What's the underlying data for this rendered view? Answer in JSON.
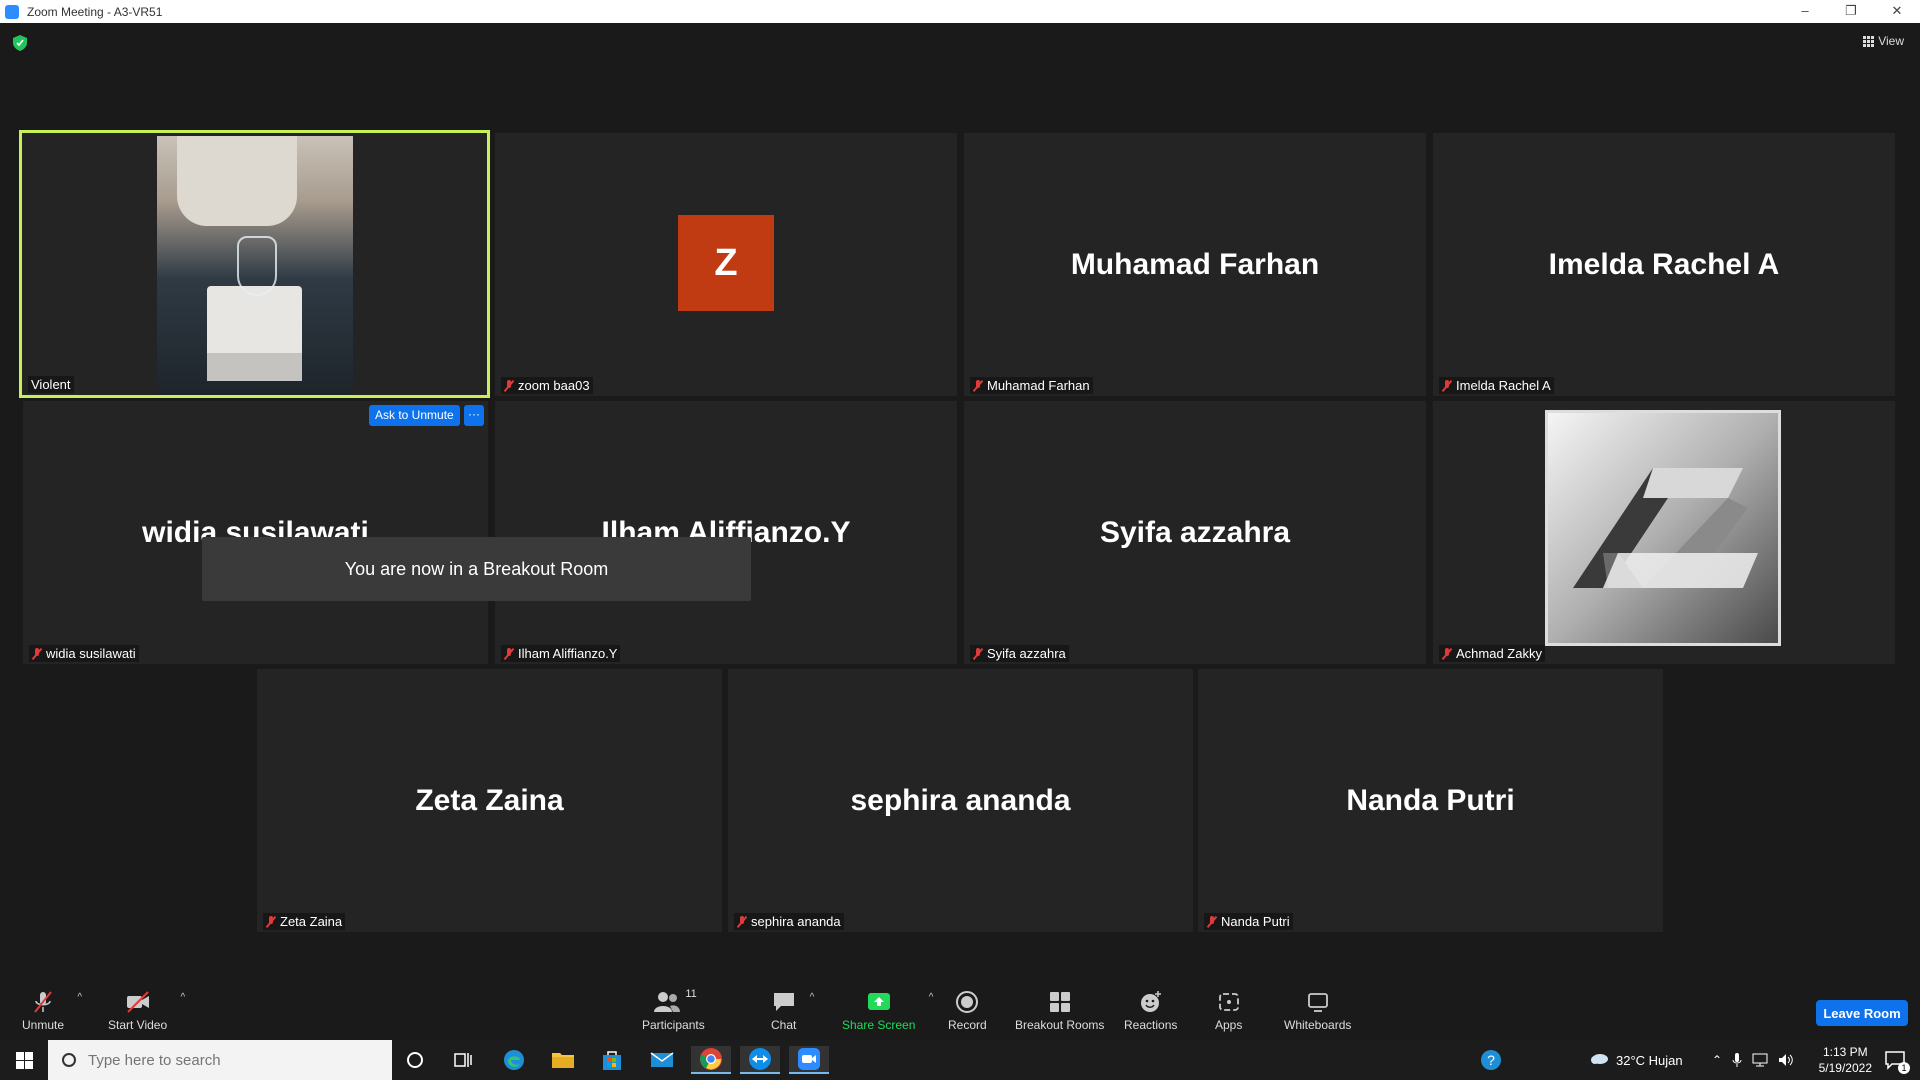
{
  "window": {
    "title": "Zoom Meeting - A3-VR51",
    "minimize": "–",
    "restore": "❐",
    "close": "✕"
  },
  "top": {
    "view_label": "View"
  },
  "tiles": [
    {
      "name": "Violent",
      "big": ""
    },
    {
      "name": "zoom baa03",
      "big": "",
      "avatar_letter": "Z"
    },
    {
      "name": "Muhamad Farhan",
      "big": "Muhamad Farhan"
    },
    {
      "name": "Imelda Rachel A",
      "big": "Imelda Rachel A"
    },
    {
      "name": "widia susilawati",
      "big": "widia susilawati"
    },
    {
      "name": "Ilham Aliffianzo.Y",
      "big": "Ilham Aliffianzo.Y"
    },
    {
      "name": "Syifa azzahra",
      "big": "Syifa azzahra"
    },
    {
      "name": "Achmad Zakky",
      "big": ""
    },
    {
      "name": "Zeta Zaina",
      "big": "Zeta Zaina"
    },
    {
      "name": "sephira ananda",
      "big": "sephira ananda"
    },
    {
      "name": "Nanda Putri",
      "big": "Nanda Putri"
    }
  ],
  "ask_unmute": "Ask to Unmute",
  "more": "···",
  "toast": "You are now in a Breakout Room",
  "toolbar": {
    "unmute": "Unmute",
    "start_video": "Start Video",
    "participants": "Participants",
    "participants_count": "11",
    "chat": "Chat",
    "share_screen": "Share Screen",
    "record": "Record",
    "breakout_rooms": "Breakout Rooms",
    "reactions": "Reactions",
    "apps": "Apps",
    "whiteboards": "Whiteboards",
    "leave": "Leave Room",
    "caret": "^"
  },
  "taskbar": {
    "search_placeholder": "Type here to search",
    "weather": "32°C  Hujan",
    "time": "1:13 PM",
    "date": "5/19/2022",
    "notif_count": "1"
  },
  "colors": {
    "active_border": "#c8f05a",
    "accent_blue": "#0e72ed",
    "share_green": "#23d959",
    "avatar_orange": "#c13b12"
  }
}
